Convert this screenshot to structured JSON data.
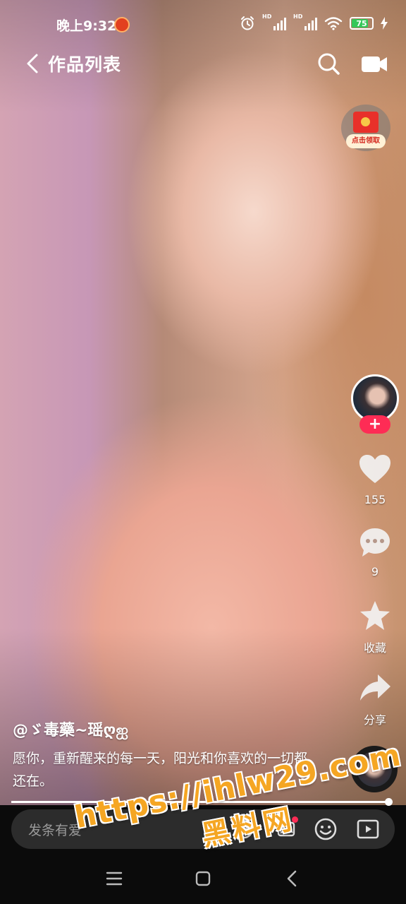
{
  "status_bar": {
    "time": "晚上9:32",
    "battery_level": "75",
    "hd_label": "HD",
    "icons": [
      "alarm-icon",
      "signal-icon",
      "signal-icon",
      "wifi-icon",
      "battery-icon",
      "charging-icon"
    ]
  },
  "top_nav": {
    "back_icon": "chevron-left-icon",
    "title": "作品列表",
    "search_icon": "search-icon",
    "camera_icon": "camera-icon"
  },
  "red_packet": {
    "label": "点击领取"
  },
  "right_rail": {
    "follow_label": "+",
    "like_count": "155",
    "comment_count": "9",
    "favorite_label": "收藏",
    "share_label": "分享"
  },
  "caption": {
    "author": "@ゞ毒藥~瑶ღஐ",
    "description": "愿你，重新醒来的每一天，阳光和你喜欢的一切都还在。"
  },
  "progress": {
    "fraction": 0.99
  },
  "comment_bar": {
    "placeholder": "发条有爱"
  },
  "watermark": {
    "url": "https://ihlw29.com",
    "name": "黑料网"
  },
  "colors": {
    "accent": "#fe2c55",
    "watermark": "#f5a623",
    "battery": "#34c759"
  }
}
